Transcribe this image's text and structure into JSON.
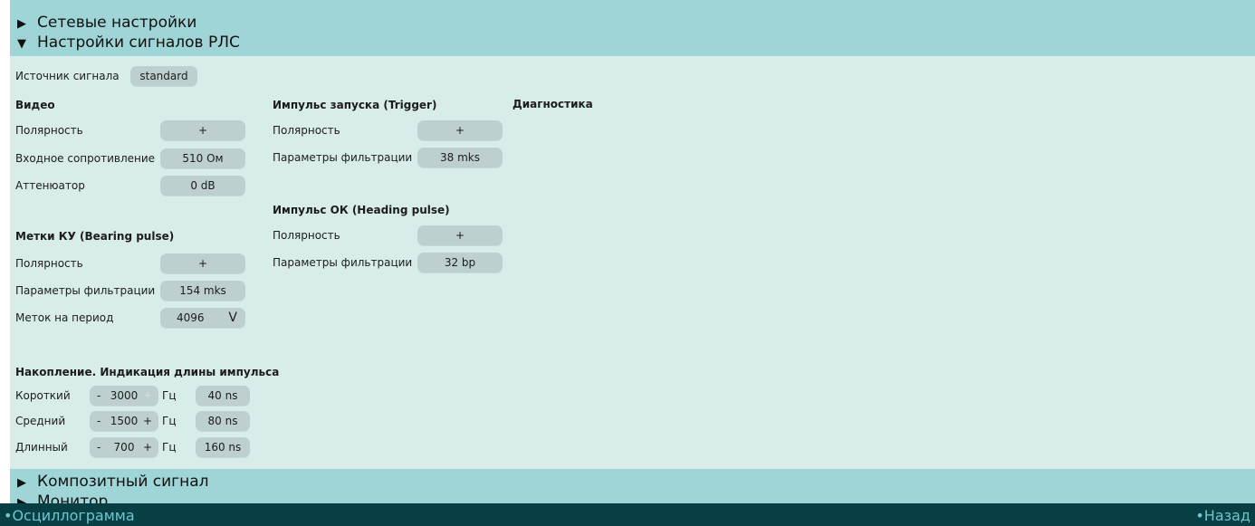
{
  "sections": {
    "network": {
      "label": "Сетевые настройки",
      "arrow": "▶"
    },
    "radar": {
      "label": "Настройки сигналов РЛС",
      "arrow": "▼"
    },
    "composite": {
      "label": "Композитный сигнал",
      "arrow": "▶"
    },
    "monitor": {
      "label": "Монитор",
      "arrow": "▶"
    }
  },
  "source": {
    "label": "Источник сигнала",
    "value": "standard"
  },
  "video": {
    "title": "Видео",
    "polarity_label": "Полярность",
    "polarity_value": "+",
    "impedance_label": "Входное сопротивление",
    "impedance_value": "510 Ом",
    "attenuator_label": "Аттенюатор",
    "attenuator_value": "0 dB"
  },
  "bearing": {
    "title": "Метки КУ (Bearing pulse)",
    "polarity_label": "Полярность",
    "polarity_value": "+",
    "filter_label": "Параметры фильтрации",
    "filter_value": "154 mks",
    "marks_label": "Меток на период",
    "marks_value": "4096",
    "marks_arrow": "V"
  },
  "trigger": {
    "title": "Импульс запуска (Trigger)",
    "polarity_label": "Полярность",
    "polarity_value": "+",
    "filter_label": "Параметры фильтрации",
    "filter_value": "38 mks"
  },
  "heading": {
    "title": "Импульс ОК (Heading pulse)",
    "polarity_label": "Полярность",
    "polarity_value": "+",
    "filter_label": "Параметры фильтрации",
    "filter_value": "32 bp"
  },
  "diagnostics": {
    "title": "Диагностика"
  },
  "accumulation": {
    "title": "Накопление. Индикация длины импульса",
    "unit": "Гц",
    "rows": [
      {
        "label": "Короткий",
        "minus": "-",
        "value": "3000",
        "plus": "+",
        "pulse": "40 ns"
      },
      {
        "label": "Средний",
        "minus": "-",
        "value": "1500",
        "plus": "+",
        "pulse": "80 ns"
      },
      {
        "label": "Длинный",
        "minus": "-",
        "value": "700",
        "plus": "+",
        "pulse": "160 ns"
      }
    ]
  },
  "footer": {
    "left": "•Осциллограмма",
    "right": "•Назад"
  }
}
